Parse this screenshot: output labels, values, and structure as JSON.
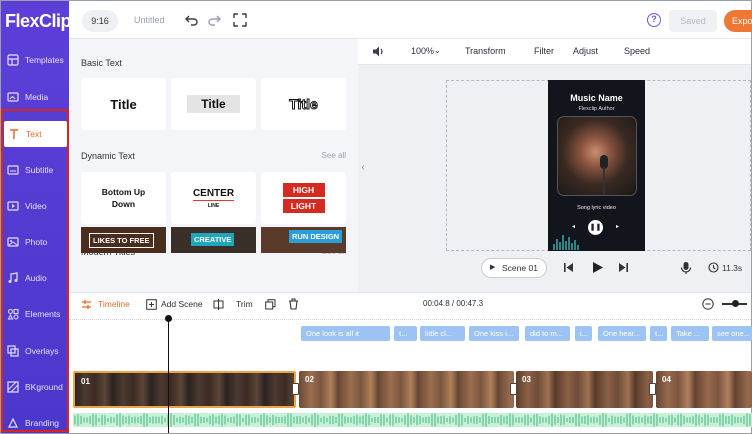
{
  "app": {
    "logo": "FlexClip",
    "ratio": "9:16",
    "title": "Untitled",
    "saved_label": "Saved",
    "export_label": "Expo",
    "help_icon": "?"
  },
  "sidebar": {
    "items": [
      {
        "label": "Templates",
        "icon": "templates-icon"
      },
      {
        "label": "Media",
        "icon": "media-icon"
      },
      {
        "label": "Text",
        "icon": "text-icon",
        "active": true
      },
      {
        "label": "Subtitle",
        "icon": "subtitle-icon"
      },
      {
        "label": "Video",
        "icon": "video-icon"
      },
      {
        "label": "Photo",
        "icon": "photo-icon"
      },
      {
        "label": "Audio",
        "icon": "audio-icon"
      },
      {
        "label": "Elements",
        "icon": "elements-icon"
      },
      {
        "label": "Overlays",
        "icon": "overlays-icon"
      },
      {
        "label": "BKground",
        "icon": "background-icon"
      },
      {
        "label": "Branding",
        "icon": "branding-icon"
      }
    ]
  },
  "panel": {
    "basic_title": "Basic Text",
    "basic_cards": [
      "Title",
      "Title",
      "Title"
    ],
    "dynamic_title": "Dynamic Text",
    "dynamic_see_all": "See all",
    "dynamic_cards": {
      "bottom_up": "Bottom Up Down",
      "center_a": "CENTER",
      "center_b": "LINE",
      "hl_a": "HIGH",
      "hl_b": "LIGHT"
    },
    "modern_title": "Modern Titles",
    "modern_see_all": "See all",
    "modern_cards": [
      "LIKES TO FREE",
      "CREATIVE",
      "RUN DESIGN"
    ]
  },
  "preview_toolbar": {
    "zoom": "100%",
    "transform": "Transform",
    "filter": "Filter",
    "adjust": "Adjust",
    "speed": "Speed"
  },
  "phone": {
    "title": "Music Name",
    "author": "Flexclip Author",
    "caption": "Song lyric video"
  },
  "playback": {
    "scene_label": "Scene",
    "scene_number": "01",
    "duration": "11.3s"
  },
  "timeline": {
    "timeline_label": "Timeline",
    "add_scene_label": "Add Scene",
    "trim_label": "Trim",
    "time": "00:04.8 / 00:47.3",
    "subtitles": [
      "One look is all it",
      "t...",
      "little cl...",
      "One kiss i...",
      "did to m...",
      "i...",
      "One hear...",
      "t...",
      "Take ...",
      "see one..."
    ],
    "clips": [
      "01",
      "02",
      "03",
      "04"
    ]
  },
  "colors": {
    "sidebar": "#5d3fd8",
    "accent": "#ee7734",
    "active_text": "#ea6a25",
    "subtitle_chip": "#9cc3f4",
    "highlight_border": "#d9261c"
  }
}
